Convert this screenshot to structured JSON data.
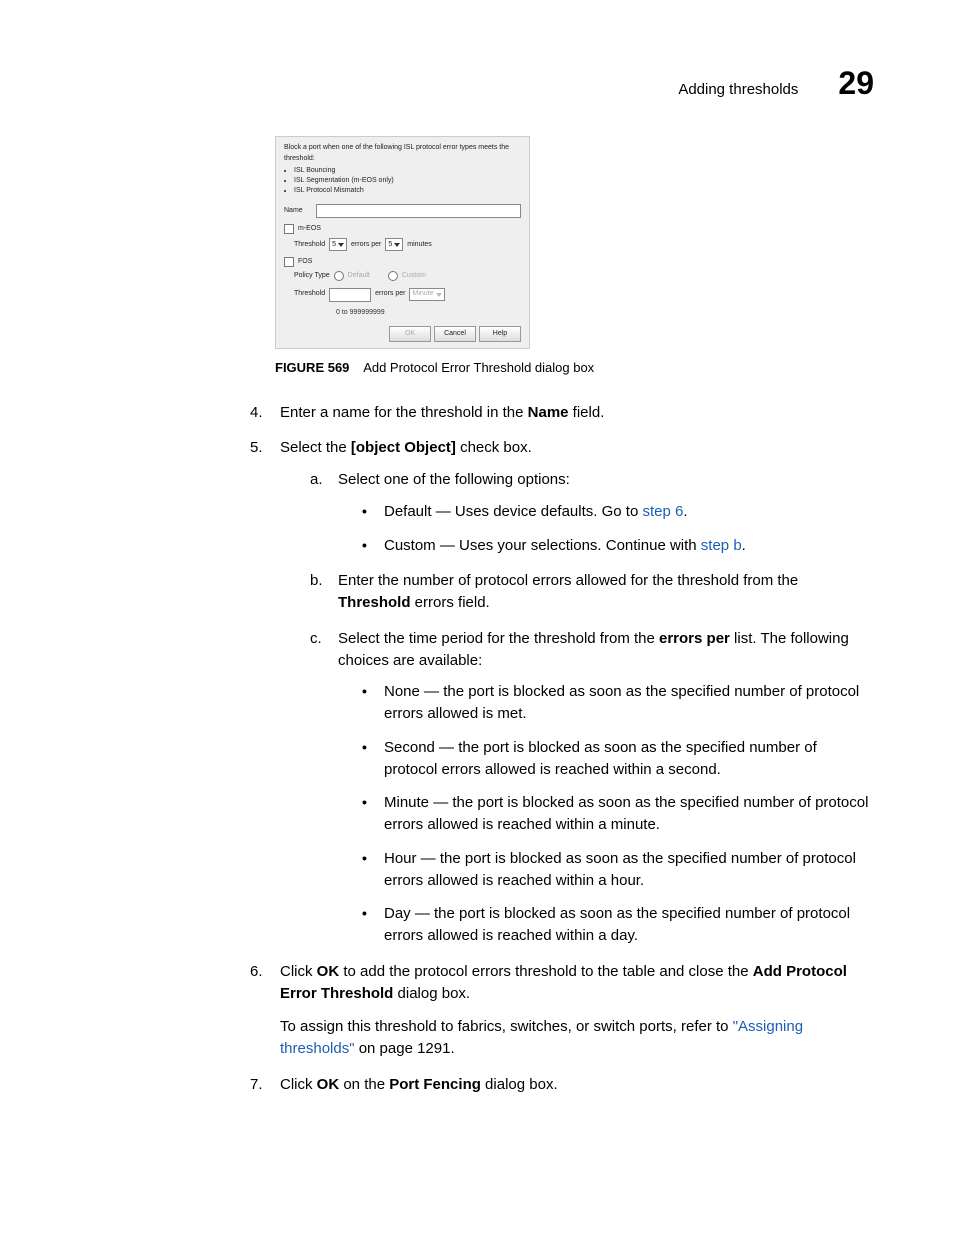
{
  "header": {
    "title": "Adding thresholds",
    "number": "29"
  },
  "dialog": {
    "intro": "Block a port when one of the following ISL protocol error types meets the threshold:",
    "bullets": [
      "ISL Bouncing",
      "ISL Segmentation (m-EOS only)",
      "ISL Protocol Mismatch"
    ],
    "nameLabel": "Name",
    "meos": {
      "check": "m-EOS",
      "thresholdLabel": "Threshold",
      "thresholdValue": "5",
      "errorsPer": "errors per",
      "perValue": "5",
      "minutes": "minutes"
    },
    "fos": {
      "check": "FOS",
      "policyType": "Policy Type",
      "default": "Default",
      "custom": "Custom",
      "thresholdLabel": "Threshold",
      "errorsPer": "errors per",
      "unit": "Minute",
      "hint": "0 to 999999999"
    },
    "buttons": {
      "ok": "OK",
      "cancel": "Cancel",
      "help": "Help"
    }
  },
  "caption": {
    "label": "FIGURE 569",
    "text": "Add Protocol Error Threshold dialog box"
  },
  "step4": {
    "num": "4.",
    "pre": "Enter a name for the threshold in the ",
    "b": "Name",
    "post": " field."
  },
  "step5": {
    "num": "5.",
    "pre": "Select the ",
    "b": {
      "alpha": "b.",
      "pre": "Enter the number of protocol errors allowed for the threshold from the ",
      "bold": "Threshold",
      "post": " errors field."
    },
    "post": " check box.",
    "a": {
      "alpha": "a.",
      "text": "Select one of the following options:",
      "opt1_pre": "Default — Uses device defaults. Go to ",
      "opt1_link": "step 6",
      "opt1_post": ".",
      "opt2_pre": "Custom — Uses your selections. Continue with ",
      "opt2_link": "step b",
      "opt2_post": "."
    },
    "c": {
      "alpha": "c.",
      "pre": "Select the time period for the threshold from the ",
      "bold": "errors per",
      "post": " list. The following choices are available:",
      "items": [
        "None — the port is blocked as soon as the specified number of protocol errors allowed is met.",
        "Second — the port is blocked as soon as the specified number of protocol errors allowed is reached within a second.",
        "Minute — the port is blocked as soon as the specified number of protocol errors allowed is reached within a minute.",
        "Hour — the port is blocked as soon as the specified number of protocol errors allowed is reached within a hour.",
        "Day — the port is blocked as soon as the specified number of protocol errors allowed is reached within a day."
      ]
    }
  },
  "step6": {
    "num": "6.",
    "pre": "Click ",
    "b1": "OK",
    "mid": " to add the protocol errors threshold to the table and close the ",
    "b2": "Add Protocol Error Threshold",
    "post": " dialog box.",
    "para_pre": "To assign this threshold to fabrics, switches, or switch ports, refer to ",
    "para_link": "\"Assigning thresholds\"",
    "para_post": " on page 1291."
  },
  "step7": {
    "num": "7.",
    "pre": "Click ",
    "b1": "OK",
    "mid": " on the ",
    "b2": "Port Fencing",
    "post": " dialog box."
  }
}
